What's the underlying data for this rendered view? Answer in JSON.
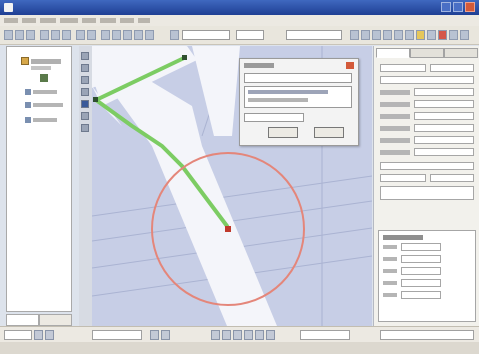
{
  "window": {
    "title": "",
    "controls": [
      "minimize-icon",
      "maximize-icon",
      "close-icon"
    ]
  },
  "menubar": {
    "items": [
      "",
      "",
      "",
      "",
      "",
      "",
      "",
      ""
    ]
  },
  "toolbar": {
    "search_value": "",
    "layer_select_value": ""
  },
  "left_panel": {
    "tree": [
      "",
      "",
      "",
      "",
      ""
    ],
    "tabs": [
      "",
      ""
    ]
  },
  "map": {
    "point_label": "",
    "route_color": "#7ccc63",
    "circle_color": "#e4867a",
    "point_color": "#c0392b",
    "background_color": "#c7cee6",
    "road_color": "#f4f5fa"
  },
  "dialog": {
    "title": "",
    "input_value": "",
    "list_items": [
      "",
      ""
    ],
    "ok_label": "",
    "cancel_label": ""
  },
  "right_panel": {
    "tabs": [
      "",
      "",
      ""
    ],
    "section_title": "",
    "fields": [
      "",
      "",
      "",
      "",
      ""
    ]
  },
  "statusbar": {
    "page_value": "",
    "scale_value": ""
  }
}
